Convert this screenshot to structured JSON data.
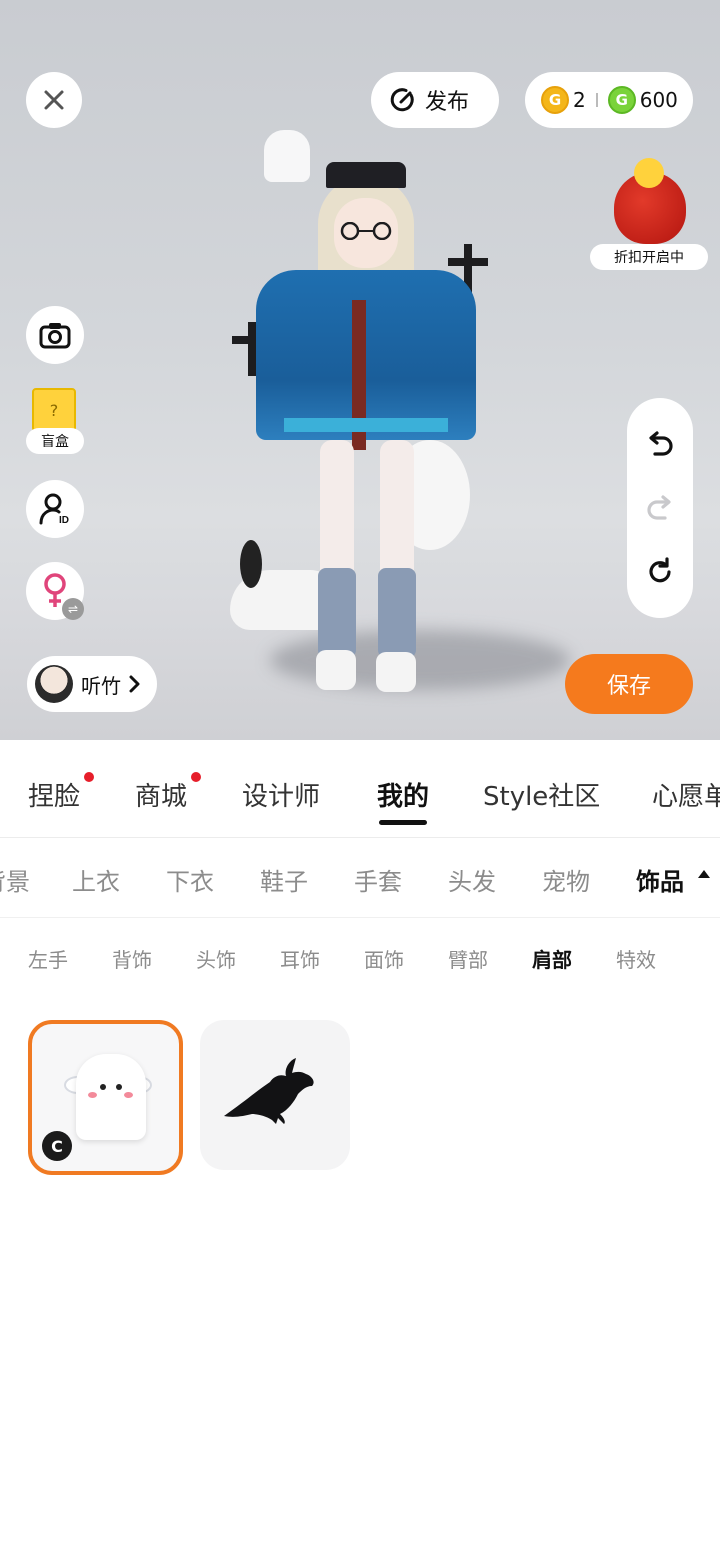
{
  "header": {
    "publish_label": "发布",
    "coins_gold": "2",
    "coins_green": "600"
  },
  "promo": {
    "label": "折扣开启中"
  },
  "side_tools": {
    "blindbox_label": "盲盒"
  },
  "user": {
    "name": "听竹"
  },
  "save_label": "保存",
  "tabs_main": [
    {
      "label": "捏脸",
      "dot": true
    },
    {
      "label": "商城",
      "dot": true
    },
    {
      "label": "设计师",
      "dot": false
    },
    {
      "label": "我的",
      "dot": false,
      "active": true
    },
    {
      "label": "Style社区",
      "dot": false
    },
    {
      "label": "心愿单",
      "dot": false
    }
  ],
  "tabs_category": [
    "背景",
    "上衣",
    "下衣",
    "鞋子",
    "手套",
    "头发",
    "宠物",
    "饰品"
  ],
  "tabs_category_active": "饰品",
  "tabs_sub": [
    "左手",
    "背饰",
    "头饰",
    "耳饰",
    "面饰",
    "臂部",
    "肩部",
    "特效"
  ],
  "tabs_sub_active": "肩部",
  "items": [
    {
      "name": "ghost-cat-shoulder-pet",
      "selected": true,
      "badge": "C"
    },
    {
      "name": "crow-shoulder-pet",
      "selected": false
    }
  ],
  "colors": {
    "accent": "#f57a1d",
    "selected_border": "#f07a22",
    "red_dot": "#e61e2a"
  }
}
